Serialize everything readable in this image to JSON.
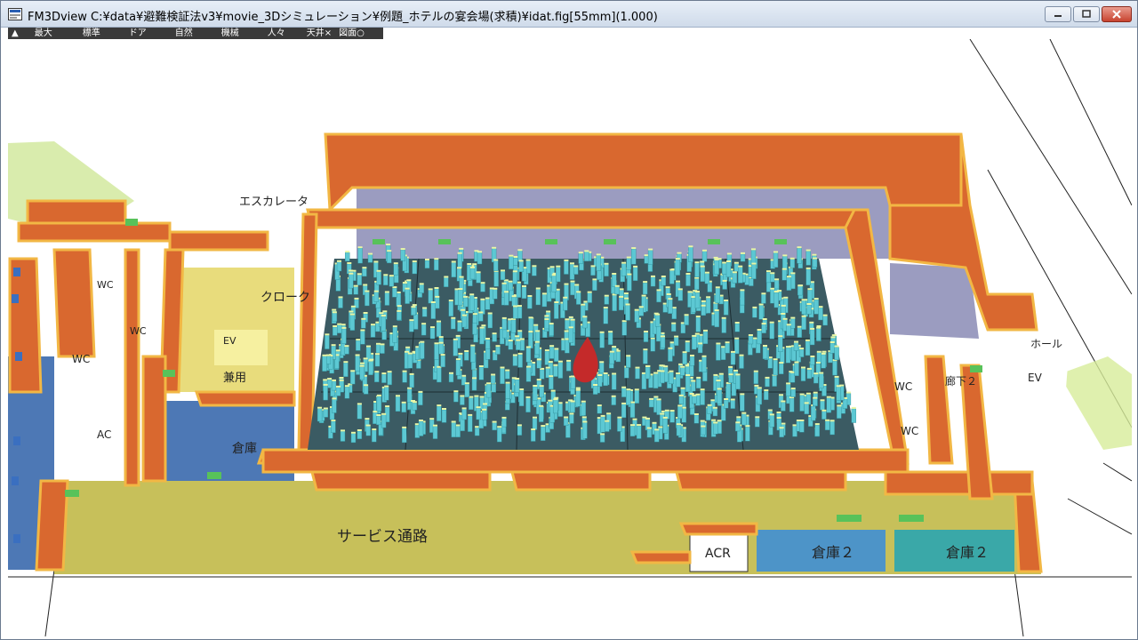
{
  "window": {
    "title": "FM3Dview C:¥data¥避難検証法v3¥movie_3Dシミュレーション¥例題_ホテルの宴会場(求積)¥idat.fig[55mm](1.000)",
    "min_icon": "minimize-icon",
    "max_icon": "maximize-icon",
    "close_icon": "close-icon"
  },
  "toolbar": {
    "items": [
      "▲",
      "最大",
      "標準",
      "ドア",
      "自然",
      "機械",
      "人々",
      "天井×",
      "図面○"
    ]
  },
  "scene": {
    "labels": {
      "escalator": "エスカレータ",
      "cloak": "クローク",
      "wc1": "WC",
      "wc2": "WC",
      "wc3": "WC",
      "wc_right1": "WC",
      "wc_right2": "WC",
      "ev_left": "EV",
      "ev_right": "EV",
      "shared": "兼用",
      "storage": "倉庫",
      "service_corridor": "サービス通路",
      "acr": "ACR",
      "storage2a": "倉庫２",
      "storage2b": "倉庫２",
      "hall": "ホール",
      "corridor2": "廊下２",
      "ac": "AC"
    },
    "colors": {
      "wall": "#d9682f",
      "wall_top": "#f2b744",
      "floor_olive": "#c7c05a",
      "floor_dark": "#3b5b63",
      "floor_lavender": "#9b9cc0",
      "floor_blue": "#4d78b5",
      "floor_teal": "#3aa8a8",
      "people": "#5cc8d3",
      "fire": "#c42a2a"
    }
  }
}
